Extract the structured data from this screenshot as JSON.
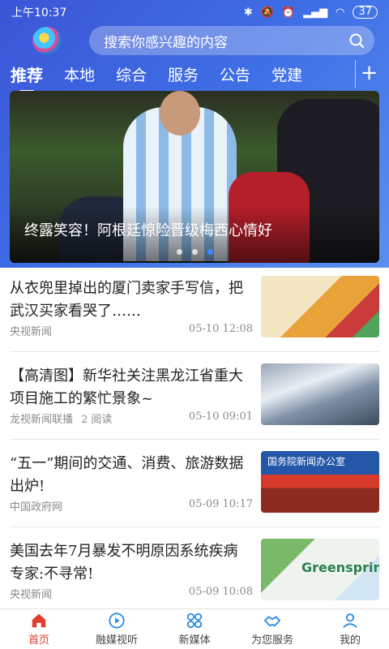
{
  "status_bar": {
    "time": "上午10:37",
    "battery": "37"
  },
  "search": {
    "placeholder": "搜索你感兴趣的内容"
  },
  "tabs": [
    {
      "label": "推荐",
      "active": true
    },
    {
      "label": "本地",
      "active": false
    },
    {
      "label": "综合",
      "active": false
    },
    {
      "label": "服务",
      "active": false
    },
    {
      "label": "公告",
      "active": false
    },
    {
      "label": "党建",
      "active": false
    }
  ],
  "banner": {
    "caption": "终露笑容！阿根廷惊险晋级梅西心情好",
    "slide_count": 3,
    "active_slide": 3
  },
  "news": [
    {
      "title": "从衣兜里掉出的厦门卖家手写信，把武汉买家看哭了……",
      "source": "央视新闻",
      "reads": "",
      "time": "05-10 12:08"
    },
    {
      "title": "【高清图】新华社关注黑龙江省重大项目施工的繁忙景象~",
      "source": "龙视新闻联播",
      "reads": "2 阅读",
      "time": "05-10 09:01"
    },
    {
      "title": "“五一”期间的交通、消费、旅游数据出炉!",
      "source": "中国政府网",
      "reads": "",
      "time": "05-09 10:17",
      "thumb_text": "国务院新闻办公室"
    },
    {
      "title": "美国去年7月暴发不明原因系统疾病 专家:不寻常!",
      "source": "央视新闻",
      "reads": "",
      "time": "05-09 10:08",
      "thumb_text": "Greenspring"
    }
  ],
  "bottom_nav": [
    {
      "label": "首页",
      "icon": "home-icon",
      "active": true
    },
    {
      "label": "融媒视听",
      "icon": "play-icon",
      "active": false
    },
    {
      "label": "新媒体",
      "icon": "grid-icon",
      "active": false
    },
    {
      "label": "为您服务",
      "icon": "handshake-icon",
      "active": false
    },
    {
      "label": "我的",
      "icon": "user-icon",
      "active": false
    }
  ],
  "colors": {
    "header_blue": "#3f6fe6",
    "active_red": "#e23c2a",
    "dot_active": "#3f86ff"
  }
}
